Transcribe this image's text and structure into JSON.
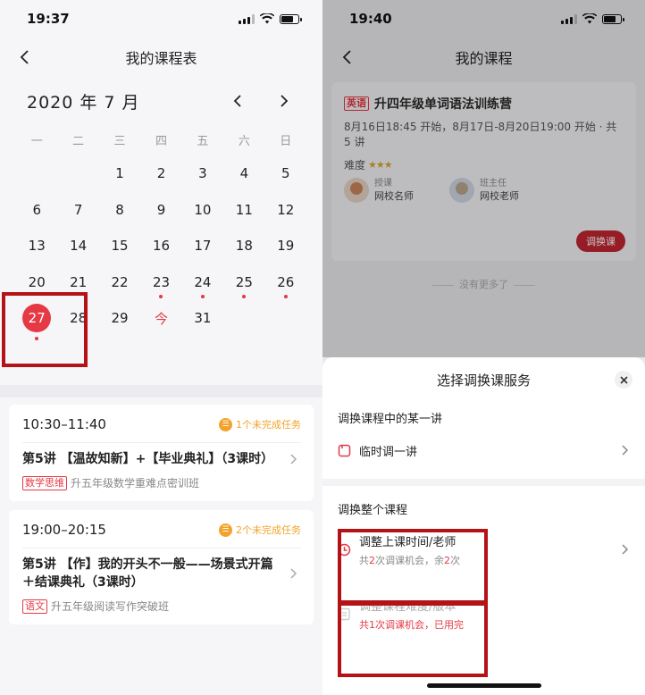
{
  "left": {
    "status_time": "19:37",
    "nav_title": "我的课程表",
    "calendar": {
      "month_label": "2020 年 7 月",
      "weekdays": [
        "一",
        "二",
        "三",
        "四",
        "五",
        "六",
        "日"
      ],
      "days": [
        {
          "label": "",
          "dot": false
        },
        {
          "label": "",
          "dot": false
        },
        {
          "label": "1",
          "dot": false
        },
        {
          "label": "2",
          "dot": false
        },
        {
          "label": "3",
          "dot": false
        },
        {
          "label": "4",
          "dot": false
        },
        {
          "label": "5",
          "dot": false
        },
        {
          "label": "6",
          "dot": false
        },
        {
          "label": "7",
          "dot": false
        },
        {
          "label": "8",
          "dot": false
        },
        {
          "label": "9",
          "dot": false
        },
        {
          "label": "10",
          "dot": false
        },
        {
          "label": "11",
          "dot": false
        },
        {
          "label": "12",
          "dot": false
        },
        {
          "label": "13",
          "dot": false
        },
        {
          "label": "14",
          "dot": false
        },
        {
          "label": "15",
          "dot": false
        },
        {
          "label": "16",
          "dot": false
        },
        {
          "label": "17",
          "dot": false
        },
        {
          "label": "18",
          "dot": false
        },
        {
          "label": "19",
          "dot": false
        },
        {
          "label": "20",
          "dot": false
        },
        {
          "label": "21",
          "dot": false
        },
        {
          "label": "22",
          "dot": false
        },
        {
          "label": "23",
          "dot": true
        },
        {
          "label": "24",
          "dot": true
        },
        {
          "label": "25",
          "dot": true
        },
        {
          "label": "26",
          "dot": true
        },
        {
          "label": "27",
          "dot": true,
          "selected": true
        },
        {
          "label": "28",
          "dot": false
        },
        {
          "label": "29",
          "dot": false
        },
        {
          "label": "今",
          "dot": false,
          "today": true
        },
        {
          "label": "31",
          "dot": false
        }
      ]
    },
    "cards": [
      {
        "time": "10:30–11:40",
        "task_text": "1个未完成任务",
        "lesson_title": "第5讲 【温故知新】+【毕业典礼】（3课时）",
        "subject_tag": "数学思维",
        "class_name": "升五年级数学重难点密训班"
      },
      {
        "time": "19:00–20:15",
        "task_text": "2个未完成任务",
        "lesson_title": "第5讲 【作】我的开头不一般——场景式开篇＋结课典礼（3课时）",
        "subject_tag": "语文",
        "class_name": "升五年级阅读写作突破班"
      }
    ]
  },
  "right": {
    "status_time": "19:40",
    "nav_title": "我的课程",
    "course": {
      "subject_tag": "英语",
      "title": "升四年级单词语法训练营",
      "schedule": "8月16日18:45 开始，8月17日-8月20日19:00 开始 · 共 5 讲",
      "difficulty_label": "难度",
      "difficulty_stars": "★★★",
      "teacher_role": "授课",
      "teacher_name": "网校名师",
      "head_role": "班主任",
      "head_name": "网校老师",
      "swap_button": "调换课"
    },
    "no_more": "没有更多了",
    "sheet": {
      "title": "选择调换课服务",
      "section1": "调换课程中的某一讲",
      "opt_temp": "临时调一讲",
      "section2": "调换整个课程",
      "opt_time_title": "调整上课时间/老师",
      "opt_time_sub_a": "共",
      "opt_time_sub_b": "2",
      "opt_time_sub_c": "次调课机会，余",
      "opt_time_sub_d": "2",
      "opt_time_sub_e": "次",
      "opt_level_title": "调整课程难度/版本",
      "opt_level_sub": "共1次调课机会，已用完"
    }
  },
  "colors": {
    "accent": "#e53945",
    "task_orange": "#f3a32a",
    "highlight_box": "#b41216"
  },
  "icons": [
    "back-arrow-icon",
    "chevron-left-icon",
    "chevron-right-icon",
    "task-icon",
    "close-icon",
    "clock-icon",
    "calendar-icon",
    "document-icon",
    "signal-icon",
    "wifi-icon",
    "battery-icon"
  ]
}
